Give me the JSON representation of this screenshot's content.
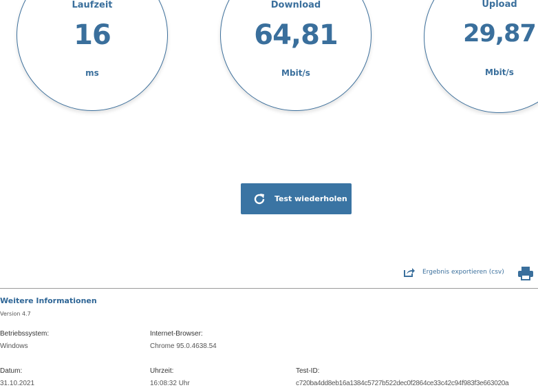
{
  "results": [
    {
      "label": "Laufzeit",
      "value": "16",
      "unit": "ms"
    },
    {
      "label": "Download",
      "value": "64,81",
      "unit": "Mbit/s"
    },
    {
      "label": "Upload",
      "value": "29,87",
      "unit": "Mbit/s"
    }
  ],
  "actions": {
    "retry_label": "Test wiederholen",
    "export_label": "Ergebnis exportieren (csv)"
  },
  "info": {
    "title": "Weitere Informationen",
    "version": "Version 4.7",
    "os_label": "Betriebssystem:",
    "os_value": "Windows",
    "browser_label": "Internet-Browser:",
    "browser_value": "Chrome 95.0.4638.54",
    "date_label": "Datum:",
    "date_value": "31.10.2021",
    "time_label": "Uhrzeit:",
    "time_value": "16:08:32 Uhr",
    "testid_label": "Test-ID:",
    "testid_value": "c720ba4dd8eb16a1384c5727b522dec0f2864ce33c42c94f983f3e663020a"
  },
  "colors": {
    "accent": "#3a74a3",
    "text_blue": "#3a6f9c"
  }
}
